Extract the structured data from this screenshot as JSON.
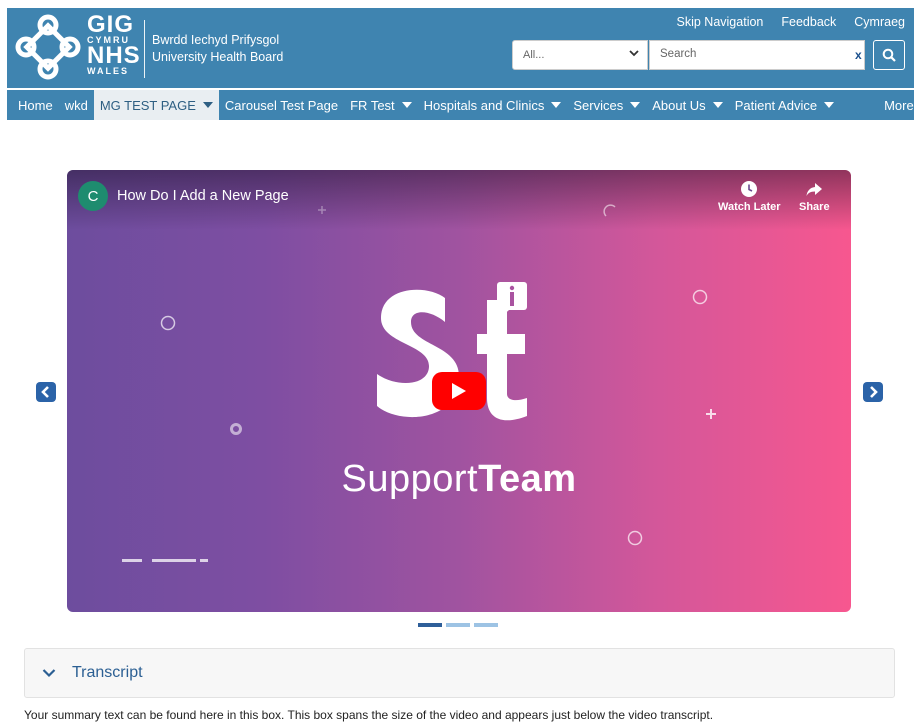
{
  "header": {
    "logo": {
      "line1": "GIG",
      "line2": "CYMRU",
      "line3": "NHS",
      "line4": "WALES"
    },
    "org_name_welsh": "Bwrdd Iechyd Prifysgol",
    "org_name_english": "University Health Board",
    "top_links": [
      "Skip Navigation",
      "Feedback",
      "Cymraeg"
    ],
    "search": {
      "scope_value": "All...",
      "placeholder": "Search",
      "clear_label": "x"
    }
  },
  "nav": {
    "items": [
      {
        "label": "Home",
        "dropdown": false
      },
      {
        "label": "wkd",
        "dropdown": false
      },
      {
        "label": "MG TEST PAGE",
        "dropdown": true,
        "active": true
      },
      {
        "label": "Carousel Test Page",
        "dropdown": false
      },
      {
        "label": "FR Test",
        "dropdown": true
      },
      {
        "label": "Hospitals and Clinics",
        "dropdown": true
      },
      {
        "label": "Services",
        "dropdown": true
      },
      {
        "label": "About Us",
        "dropdown": true
      },
      {
        "label": "Patient Advice",
        "dropdown": true
      }
    ],
    "more_label": "More"
  },
  "video": {
    "channel_initial": "C",
    "title": "How Do I Add a New Page",
    "watch_later_label": "Watch Later",
    "share_label": "Share",
    "brand_light": "Support",
    "brand_bold": "Team",
    "gradient_start": "#6d4d9e",
    "gradient_end": "#f7578f",
    "play_color": "#ff0000"
  },
  "carousel": {
    "slides": 3,
    "active_index": 0
  },
  "transcript": {
    "label": "Transcript"
  },
  "summary_text": "Your summary text can be found here in this box. This box spans the size of the video and appears just below the video transcript."
}
